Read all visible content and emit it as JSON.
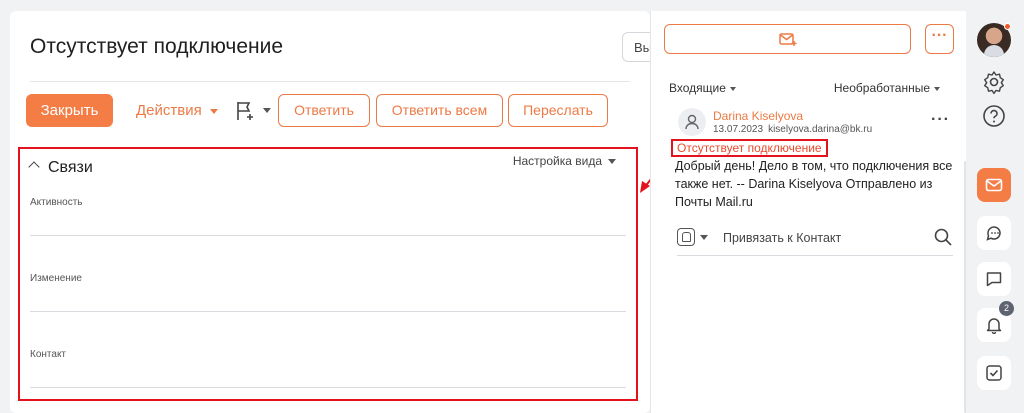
{
  "main": {
    "title": "Отсутствует подключение",
    "ghost_button_label": "Вы",
    "toolbar": {
      "close_label": "Закрыть",
      "actions_label": "Действия",
      "reply_label": "Ответить",
      "reply_all_label": "Ответить всем",
      "forward_label": "Переслать"
    },
    "relations": {
      "title": "Связи",
      "view_settings_label": "Настройка вида",
      "fields": [
        {
          "label": "Активность",
          "value": ""
        },
        {
          "label": "Изменение",
          "value": ""
        },
        {
          "label": "Контакт",
          "value": ""
        }
      ]
    }
  },
  "mail_panel": {
    "folder_filter": "Входящие",
    "status_filter": "Необработанные",
    "message": {
      "sender": "Darina Kiselyova",
      "date": "13.07.2023",
      "email": "kiselyova.darina@bk.ru",
      "subject": "Отсутствует подключение",
      "body": "Добрый день! Дело в том, что подключения все также нет. -- Darina Kiselyova Отправлено из Почты Mail.ru"
    },
    "link_placeholder": "Привязать к Контакт"
  },
  "rail": {
    "notification_count": "2"
  },
  "colors": {
    "accent": "#f47c45",
    "highlight_border": "#e4121c"
  }
}
